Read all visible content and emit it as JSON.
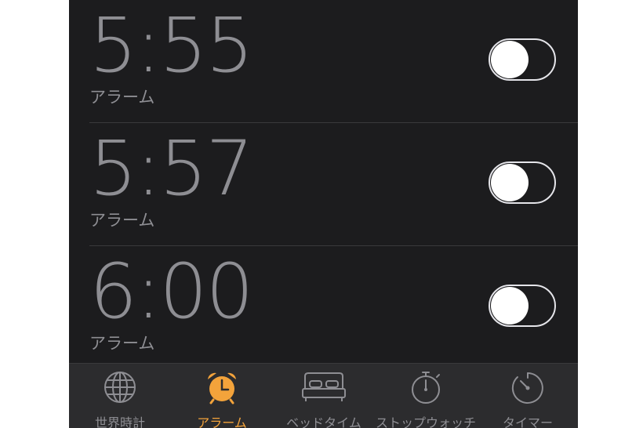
{
  "alarms": [
    {
      "time": "5:55",
      "label": "アラーム",
      "enabled": false
    },
    {
      "time": "5:57",
      "label": "アラーム",
      "enabled": false
    },
    {
      "time": "6:00",
      "label": "アラーム",
      "enabled": false
    }
  ],
  "tabs": [
    {
      "label": "世界時計",
      "icon": "globe-icon",
      "active": false
    },
    {
      "label": "アラーム",
      "icon": "alarm-clock-icon",
      "active": true
    },
    {
      "label": "ベッドタイム",
      "icon": "bed-icon",
      "active": false
    },
    {
      "label": "ストップウォッチ",
      "icon": "stopwatch-icon",
      "active": false
    },
    {
      "label": "タイマー",
      "icon": "timer-icon",
      "active": false
    }
  ],
  "colors": {
    "background": "#1c1c1e",
    "tabbar": "#2c2c2e",
    "accent": "#f3a33b",
    "inactive": "#8e8e93"
  }
}
